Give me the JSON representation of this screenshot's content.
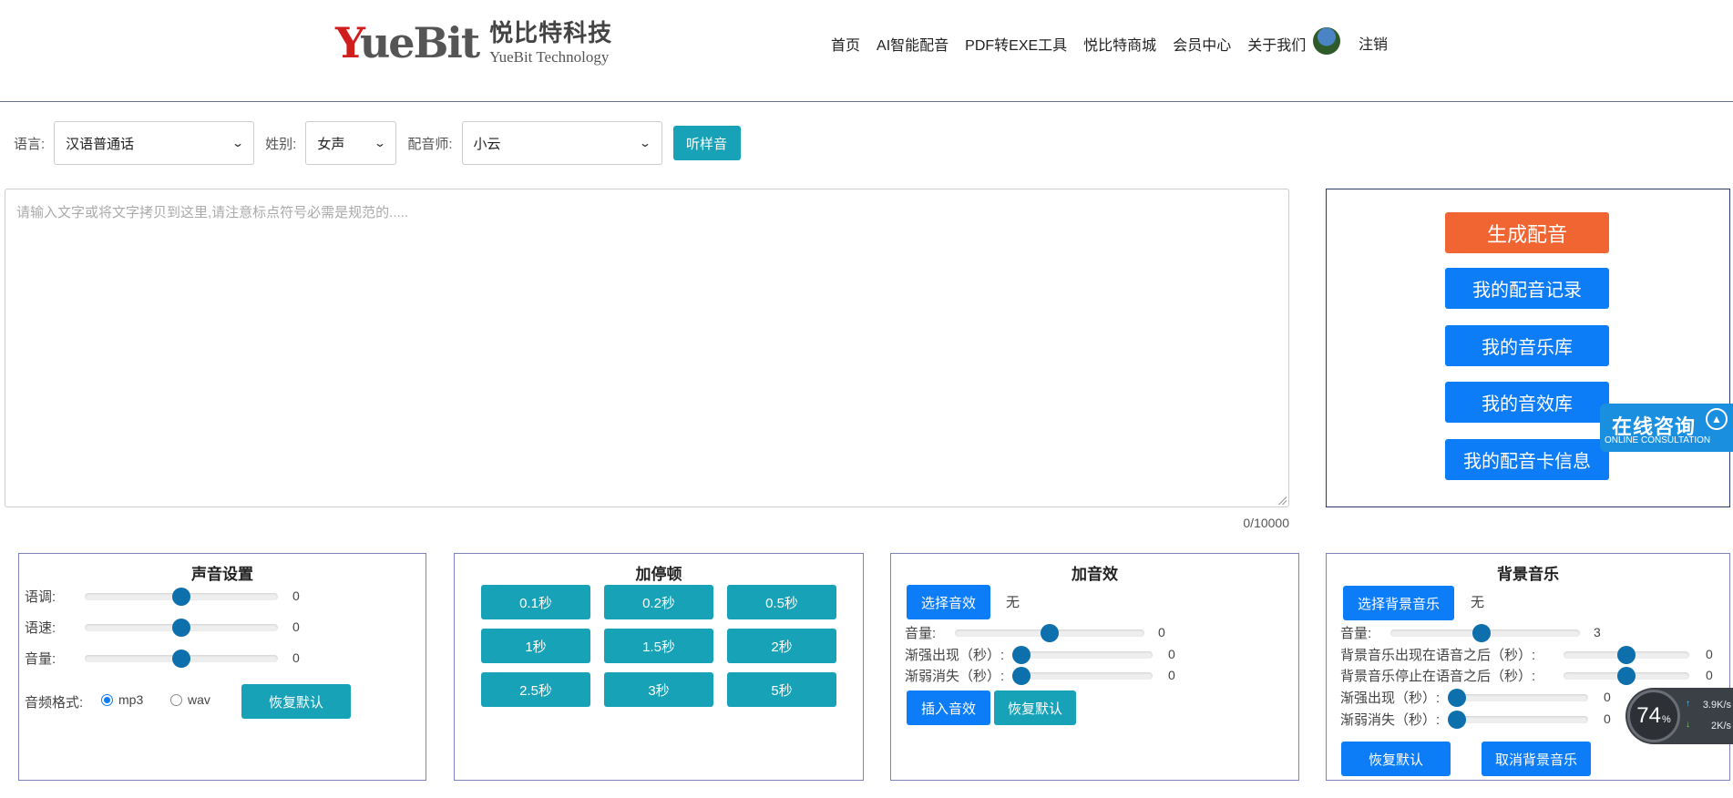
{
  "header": {
    "logo_mark_y": "Y",
    "logo_mark_rest": "ueBit",
    "logo_cn": "悦比特科技",
    "logo_en": "YueBit Technology",
    "nav": [
      "首页",
      "AI智能配音",
      "PDF转EXE工具",
      "悦比特商城",
      "会员中心",
      "关于我们"
    ],
    "logout": "注销"
  },
  "options": {
    "language_label": "语言:",
    "language_value": "汉语普通话",
    "gender_label": "姓别:",
    "gender_value": "女声",
    "voicer_label": "配音师:",
    "voicer_value": "小云",
    "listen_button": "听样音"
  },
  "editor": {
    "placeholder": "请输入文字或将文字拷贝到这里,请注意标点符号必需是规范的.....",
    "counter": "0/10000"
  },
  "actions": {
    "generate": "生成配音",
    "records": "我的配音记录",
    "music_lib": "我的音乐库",
    "sfx_lib": "我的音效库",
    "card_info": "我的配音卡信息"
  },
  "consult": {
    "title": "在线咨询",
    "subtitle": "ONLINE CONSULTATION"
  },
  "voice_settings": {
    "title": "声音设置",
    "rows": [
      {
        "label": "语调:",
        "value": "0",
        "level": 0.5
      },
      {
        "label": "语速:",
        "value": "0",
        "level": 0.5
      },
      {
        "label": "音量:",
        "value": "0",
        "level": 0.5
      }
    ],
    "format_label": "音频格式:",
    "format_mp3": "mp3",
    "format_wav": "wav",
    "selected_format": "mp3",
    "reset": "恢复默认"
  },
  "pause": {
    "title": "加停顿",
    "buttons": [
      "0.1秒",
      "0.2秒",
      "0.5秒",
      "1秒",
      "1.5秒",
      "2秒",
      "2.5秒",
      "3秒",
      "5秒"
    ]
  },
  "sfx": {
    "title": "加音效",
    "choose": "选择音效",
    "current": "无",
    "rows": [
      {
        "label": "音量:",
        "value": "0",
        "level": 0.5
      },
      {
        "label": "渐强出现（秒）:",
        "value": "0",
        "level": 0
      },
      {
        "label": "渐弱消失（秒）:",
        "value": "0",
        "level": 0
      }
    ],
    "insert": "插入音效",
    "reset": "恢复默认"
  },
  "bgm": {
    "title": "背景音乐",
    "choose": "选择背景音乐",
    "current": "无",
    "rows": [
      {
        "label": "音量:",
        "value": "3",
        "level": 0.48
      },
      {
        "label": "背景音乐出现在语音之后（秒）:",
        "value": "0",
        "level": 0.5
      },
      {
        "label": "背景音乐停止在语音之后（秒）:",
        "value": "0",
        "level": 0.5
      },
      {
        "label": "渐强出现（秒）:",
        "value": "0",
        "level": 0
      },
      {
        "label": "渐弱消失（秒）:",
        "value": "0",
        "level": 0
      }
    ],
    "reset": "恢复默认",
    "cancel": "取消背景音乐"
  },
  "net_widget": {
    "percent": "74",
    "percent_unit": "%",
    "up": "3.9K/s",
    "down": "2K/s"
  }
}
